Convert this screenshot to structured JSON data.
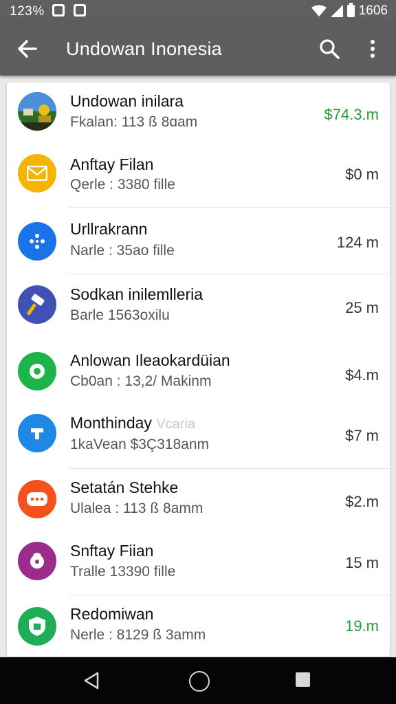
{
  "status_bar": {
    "time": "123%",
    "battery_text": "1606"
  },
  "app_bar": {
    "title": "Undowan Inonesia"
  },
  "colors": {
    "accent_green": "#1e9e34",
    "app_bar": "#5e5e5e"
  },
  "items": [
    {
      "title": "Undowan inilara",
      "subtitle": "Fkalan: 113 ß 8ɑam",
      "amount": "$74.3.m",
      "icon": "photo-thumbnail"
    },
    {
      "title": "Anftay Filan",
      "subtitle": "Qerle : 3380 fille",
      "amount": "$0 m",
      "icon": "mail-icon"
    },
    {
      "title": "Urllrakrann",
      "subtitle": "Narle : 35ao fille",
      "amount": "124 m",
      "icon": "dots-icon"
    },
    {
      "title": "Sodkan inilemlleria",
      "subtitle": "Barle 1563oxilu",
      "amount": "25 m",
      "icon": "hammer-icon"
    },
    {
      "title": "Anlowan Ileaokardüian",
      "subtitle": "Cb0an : 13,2/ Makinm",
      "amount": "$4.m",
      "icon": "circle-icon"
    },
    {
      "title": "Monthinday",
      "title_faded": "Vcaria",
      "subtitle": "1kaVean $3Ç318anm",
      "amount": "$7 m",
      "icon": "tag-icon"
    },
    {
      "title": "Setatán Stehke",
      "subtitle": "Ulalea : 113 ß 8amm",
      "amount": "$2.m",
      "icon": "chat-icon"
    },
    {
      "title": "Snftay Fiian",
      "subtitle": "Tralle 13390 fille",
      "amount": "15 m",
      "icon": "lock-icon"
    },
    {
      "title": "Redomiwan",
      "subtitle": "Nerle : 8129 ß 3amm",
      "amount": "19.m",
      "icon": "shield-icon"
    }
  ]
}
